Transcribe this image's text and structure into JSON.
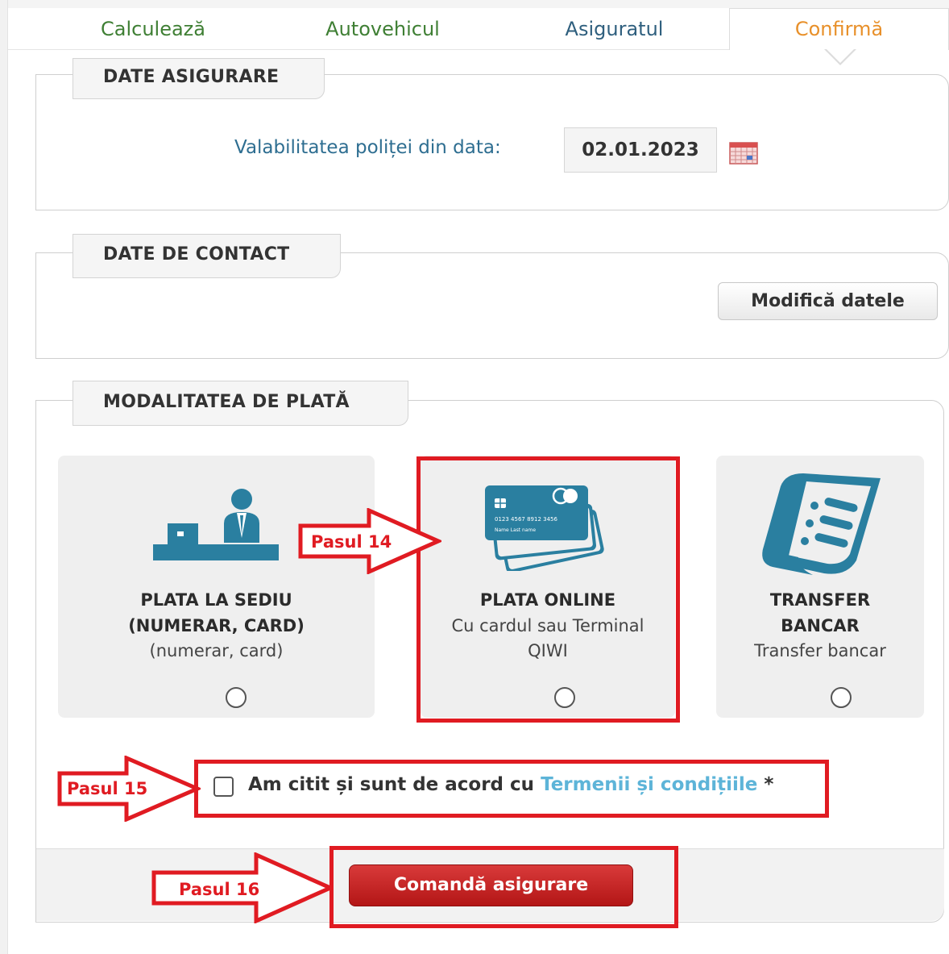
{
  "tabs": [
    {
      "label": "Calculează"
    },
    {
      "label": "Autovehicul"
    },
    {
      "label": "Asiguratul"
    },
    {
      "label": "Confirmă"
    }
  ],
  "insurance": {
    "legend": "DATE ASIGURARE",
    "validity_label": "Valabilitatea poliței din data:",
    "validity_date": "02.01.2023"
  },
  "contact": {
    "legend": "DATE DE CONTACT",
    "modify_button": "Modifică datele"
  },
  "payment": {
    "legend": "MODALITATEA DE PLATĂ",
    "options": [
      {
        "title_line1": "PLATA LA SEDIU",
        "title_line2": "(NUMERAR, CARD)",
        "subtitle": "(numerar, card)",
        "selected": false
      },
      {
        "title_line1": "PLATA ONLINE",
        "subtitle_line1": "Cu cardul sau Terminal",
        "subtitle_line2": "QIWI",
        "selected": false
      },
      {
        "title_line1": "TRANSFER",
        "title_line2": "BANCAR",
        "subtitle": "Transfer bancar",
        "selected": false
      }
    ],
    "card_text": {
      "number": "0123 4567 8912 3456",
      "name": "Name Last name"
    }
  },
  "agreement": {
    "text": "Am citit și sunt de acord cu ",
    "link": "Termenii și condițiile",
    "required_mark": " *",
    "checked": false
  },
  "order_button": "Comandă asigurare",
  "annotations": {
    "step14": "Pasul 14",
    "step15": "Pasul 15",
    "step16": "Pasul 16",
    "color": "#e01b22"
  },
  "colors": {
    "tab_done": "#3f7f34",
    "tab_active": "#e8902a",
    "icon_blue": "#2a7fa0",
    "link": "#5db4d8",
    "order_button": "#c62828"
  }
}
